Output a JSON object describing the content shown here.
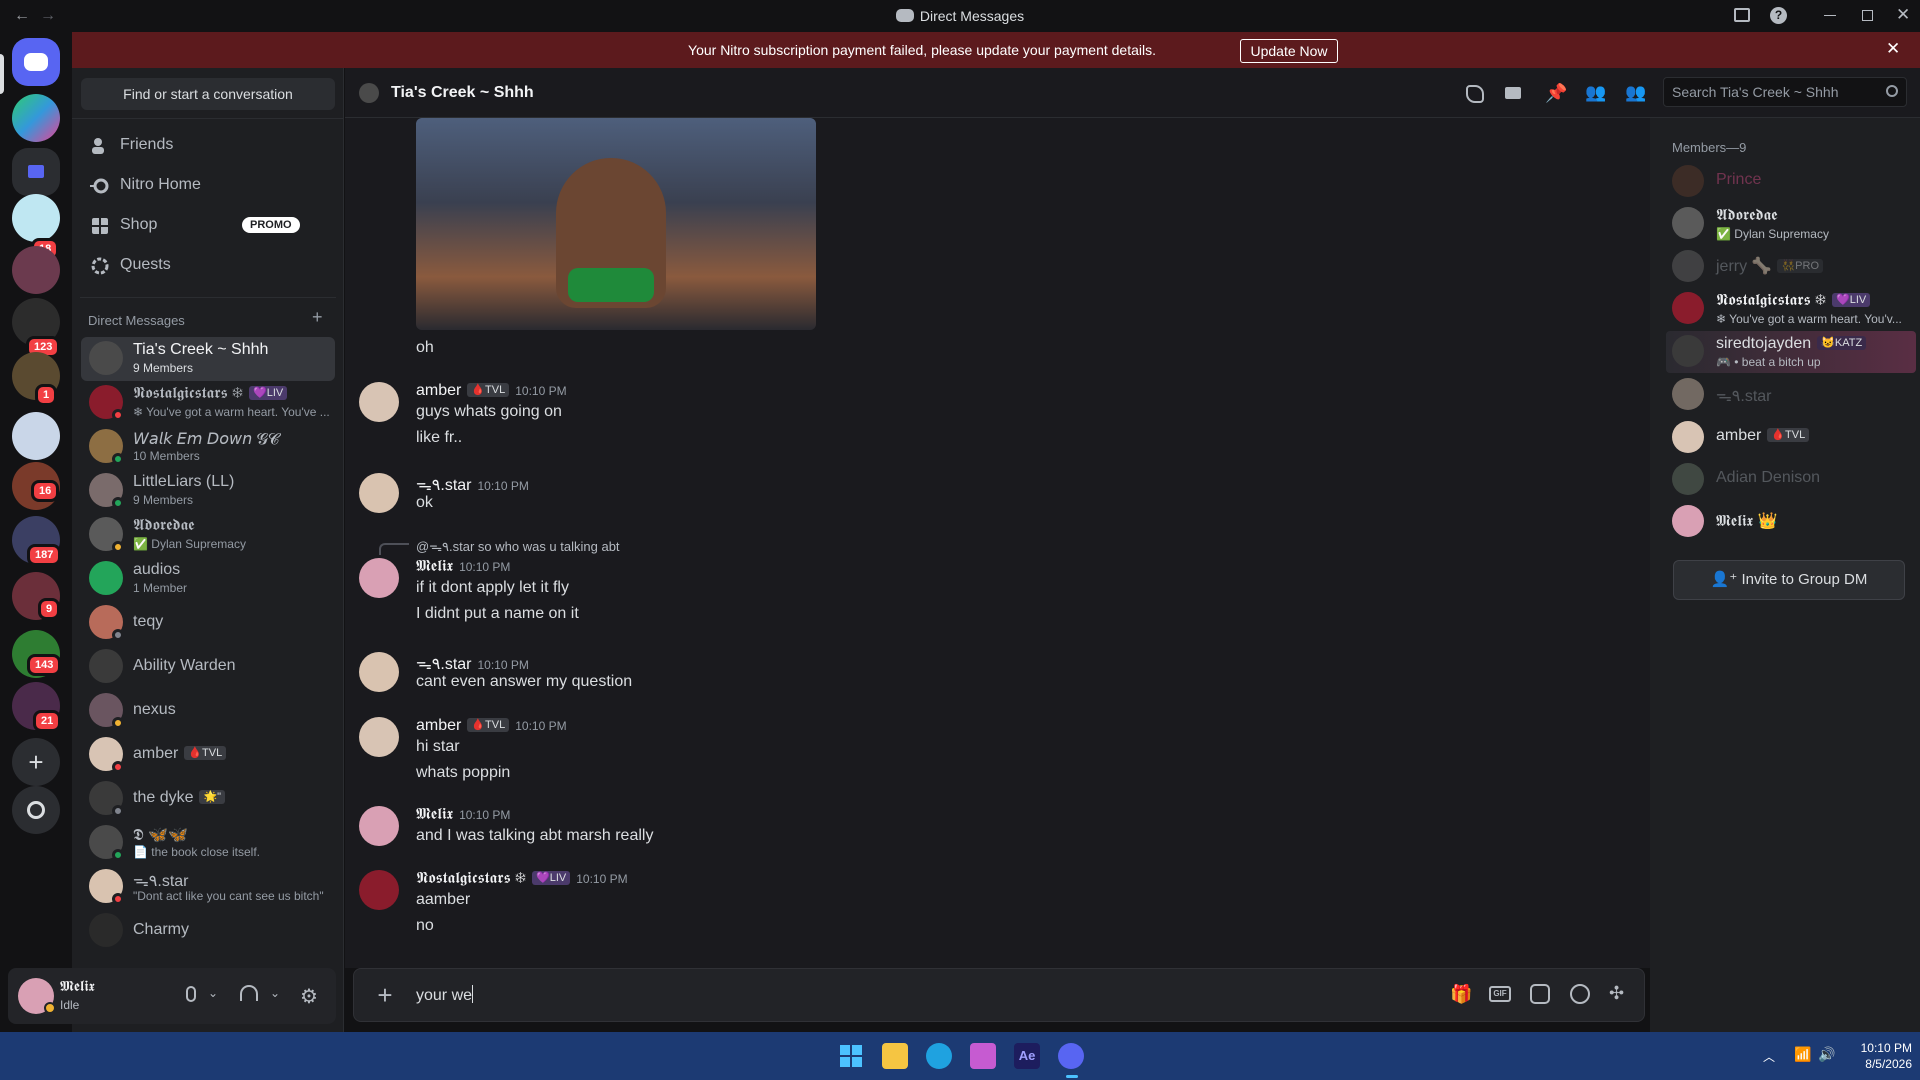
{
  "window": {
    "title": "Direct Messages"
  },
  "banner": {
    "text": "Your Nitro subscription payment failed, please update your payment details.",
    "button": "Update Now"
  },
  "servers": {
    "badges": [
      "18",
      "123",
      "1",
      "16",
      "187",
      "9",
      "143",
      "21"
    ]
  },
  "sidebar": {
    "find_placeholder": "Find or start a conversation",
    "nav": [
      {
        "label": "Friends"
      },
      {
        "label": "Nitro Home"
      },
      {
        "label": "Shop",
        "badge": "PROMO"
      },
      {
        "label": "Quests"
      }
    ],
    "dm_header": "Direct Messages",
    "dms": [
      {
        "name": "Tia's Creek ~ Shhh",
        "sub": "9 Members",
        "active": true
      },
      {
        "name": "𝕹𝖔𝖘𝖙𝖆𝖑𝖌𝖎𝖈𝖘𝖙𝖆𝖗𝖘 ❄",
        "tag": "💜LIV",
        "sub": "❄ You've got a warm heart. You've ..."
      },
      {
        "name": "𝘞𝘢𝘭𝘬 𝘌𝘮 𝘋𝘰𝘸𝘯 𝓖𝓒",
        "sub": "10 Members"
      },
      {
        "name": "LittleLiars (LL)",
        "sub": "9 Members"
      },
      {
        "name": "𝕬𝖉𝖔𝖗𝖊𝖉𝖆𝖊",
        "sub": "✅ Dylan Supremacy"
      },
      {
        "name": "audios",
        "sub": "1 Member"
      },
      {
        "name": "teqy"
      },
      {
        "name": "Ability Warden"
      },
      {
        "name": "nexus"
      },
      {
        "name": "amber",
        "tag": "🩸TVL"
      },
      {
        "name": "the dyke",
        "tag": "🌟\""
      },
      {
        "name": "𝕯 🦋🦋",
        "sub": "📄 the book close itself."
      },
      {
        "name": "ᯓ٩.star",
        "sub": "\"Dont act like you cant see us bitch\""
      },
      {
        "name": "Charmy"
      }
    ],
    "user": {
      "name": "𝕸𝖊𝖑𝖎𝖝",
      "status": "Idle"
    }
  },
  "chat": {
    "channel": "Tia's Creek ~ Shhh",
    "search_placeholder": "Search Tia's Creek ~ Shhh",
    "messages": [
      {
        "lines": [
          "oh"
        ]
      },
      {
        "user": "amber",
        "tag": "🩸TVL",
        "time": "10:10 PM",
        "lines": [
          "guys whats going on",
          "like fr.."
        ]
      },
      {
        "user": "ᯓ٩.star",
        "time": "10:10 PM",
        "lines": [
          "ok"
        ]
      },
      {
        "reply": "@ᯓ٩.star so who was u talking abt",
        "user": "𝕸𝖊𝖑𝖎𝖝",
        "time": "10:10 PM",
        "lines": [
          "if it dont apply let it fly",
          "I didnt put a name on it"
        ]
      },
      {
        "user": "ᯓ٩.star",
        "time": "10:10 PM",
        "lines": [
          "cant even answer my question"
        ]
      },
      {
        "user": "amber",
        "tag": "🩸TVL",
        "time": "10:10 PM",
        "lines": [
          "hi star",
          "whats poppin"
        ]
      },
      {
        "user": "𝕸𝖊𝖑𝖎𝖝",
        "time": "10:10 PM",
        "lines": [
          "and I was talking abt marsh really"
        ]
      },
      {
        "user": "𝕹𝖔𝖘𝖙𝖆𝖑𝖌𝖎𝖈𝖘𝖙𝖆𝖗𝖘 ❄",
        "tag": "💜LIV",
        "time": "10:10 PM",
        "lines": [
          "aamber",
          "no"
        ]
      }
    ],
    "composer_value": "your we"
  },
  "members": {
    "header": "Members—9",
    "list": [
      {
        "name": "Prince",
        "color": "#5a2a3e"
      },
      {
        "name": "𝕬𝖉𝖔𝖗𝖊𝖉𝖆𝖊",
        "sub": "✅ Dylan Supremacy",
        "color": "#dbdee1"
      },
      {
        "name": "jerry 🦴",
        "tag": "👯PRO",
        "color": "#5d5f66"
      },
      {
        "name": "𝕹𝖔𝖘𝖙𝖆𝖑𝖌𝖎𝖈𝖘𝖙𝖆𝖗𝖘 ❄",
        "tag": "💜LIV",
        "sub": "❄ You've got a warm heart. You'v...",
        "color": "#f2f3f5"
      },
      {
        "name": "siredtojayden",
        "tag": "😺KATZ",
        "sub": "🎮 • beat a bitch up",
        "color": "#dbdee1"
      },
      {
        "name": "ᯓ٩.star",
        "color": "#5d5f66"
      },
      {
        "name": "amber",
        "tag": "🩸TVL",
        "color": "#dbdee1"
      },
      {
        "name": "Adian Denison",
        "color": "#5d5f66"
      },
      {
        "name": "𝕸𝖊𝖑𝖎𝖝 👑",
        "color": "#dbdee1"
      }
    ],
    "invite_button": "Invite to Group DM"
  },
  "taskbar": {
    "time": "10:10 PM",
    "date": "8/5/2026"
  },
  "colors": {
    "accent": "#5865f2",
    "danger": "#f23f43",
    "banner": "#5c1a1d"
  }
}
